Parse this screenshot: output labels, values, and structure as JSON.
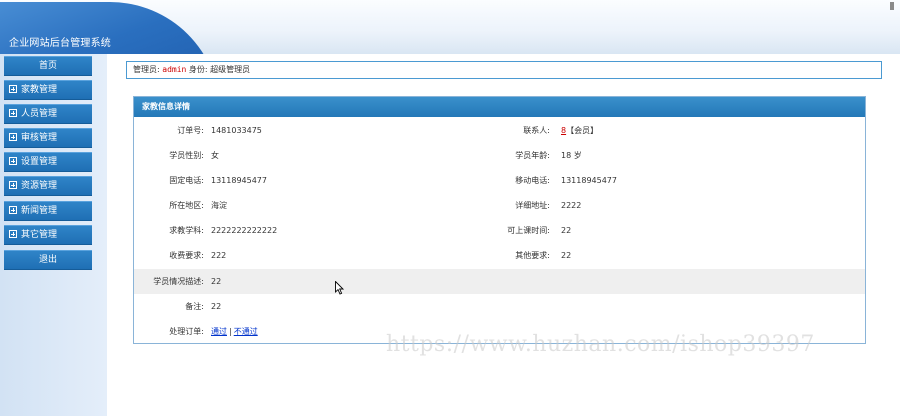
{
  "header": {
    "system_title": "企业网站后台管理系统"
  },
  "sidebar": {
    "items": [
      {
        "label": "首页",
        "icon": ""
      },
      {
        "label": "家教管理",
        "icon": "plus-box-icon"
      },
      {
        "label": "人员管理",
        "icon": "plus-box-icon"
      },
      {
        "label": "审核管理",
        "icon": "plus-box-icon"
      },
      {
        "label": "设置管理",
        "icon": "plus-box-icon"
      },
      {
        "label": "资源管理",
        "icon": "plus-box-icon"
      },
      {
        "label": "新闻管理",
        "icon": "plus-box-icon"
      },
      {
        "label": "其它管理",
        "icon": "plus-box-icon"
      },
      {
        "label": "退出",
        "icon": ""
      }
    ]
  },
  "adminbar": {
    "admin_label": "管理员:",
    "admin_name": "admin",
    "role_label": "身份:",
    "role_value": "超级管理员"
  },
  "panel": {
    "title": "家教信息详情",
    "fields": {
      "order_no_label": "订单号:",
      "order_no": "1481033475",
      "contact_label": "联系人:",
      "contact_name": "8",
      "contact_tag": "【会员】",
      "gender_label": "学员性别:",
      "gender": "女",
      "age_label": "学员年龄:",
      "age": "18 岁",
      "phone_label": "固定电话:",
      "phone": "13118945477",
      "mobile_label": "移动电话:",
      "mobile": "13118945477",
      "area_label": "所在地区:",
      "area": "海淀",
      "address_label": "详细地址:",
      "address": "2222",
      "subject_label": "求教学科:",
      "subject": "2222222222222",
      "time_label": "可上课时间:",
      "time": "22",
      "fee_label": "收费要求:",
      "fee": "222",
      "other_label": "其他要求:",
      "other": "22",
      "desc_label": "学员情况描述:",
      "desc": "22",
      "note_label": "备注:",
      "note": "22",
      "action_label": "处理订单:",
      "approve": "通过",
      "separator": "|",
      "reject": "不通过"
    }
  },
  "watermark": "https://www.huzhan.com/ishop39397",
  "colors": {
    "nav_button": "#2378b8",
    "panel_header": "#2f85c2",
    "accent_red": "#cc0000",
    "link_blue": "#0033cc"
  }
}
